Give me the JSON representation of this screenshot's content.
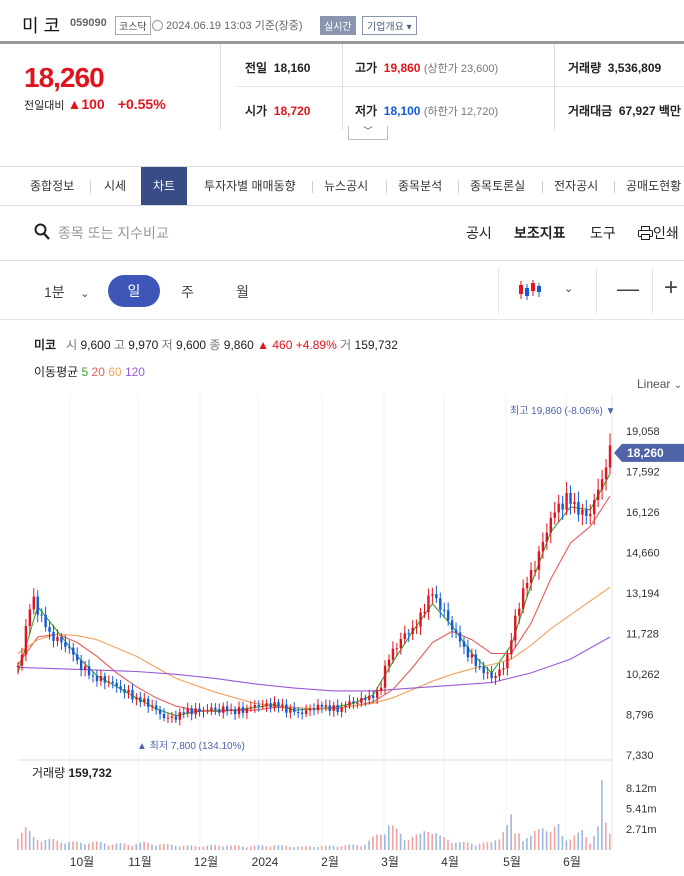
{
  "header": {
    "name": "미 코",
    "code": "059090",
    "market": "코스닥",
    "timestamp": "2024.06.19 13:03  기준(장중)",
    "realtime": "실시간",
    "overview": "기업개요"
  },
  "quote": {
    "price": "18,260",
    "change_label": "전일대비",
    "change": "▲100",
    "change_pct": "+0.55%",
    "prev_label": "전일",
    "prev": "18,160",
    "high_label": "고가",
    "high": "19,860",
    "upper_limit": "(상한가 23,600)",
    "volume_label": "거래량",
    "volume": "3,536,809",
    "open_label": "시가",
    "open": "18,720",
    "low_label": "저가",
    "low": "18,100",
    "lower_limit": "(하한가 12,720)",
    "amount_label": "거래대금",
    "amount": "67,927 백만"
  },
  "tabs": [
    "종합정보",
    "시세",
    "차트",
    "투자자별 매매동향",
    "뉴스공시",
    "종목분석",
    "종목토론실",
    "전자공시",
    "공매도현황"
  ],
  "search": {
    "placeholder": "종목 또는 지수비교",
    "tools": [
      "공시",
      "보조지표",
      "도구",
      "인쇄"
    ]
  },
  "intervals": {
    "minute": "1분",
    "day": "일",
    "week": "주",
    "month": "월"
  },
  "legend": {
    "name": "미코",
    "open_k": "시",
    "open": "9,600",
    "high_k": "고",
    "high": "9,970",
    "low_k": "저",
    "low": "9,600",
    "close_k": "종",
    "close": "9,860",
    "chg": "▲ 460 +4.89%",
    "vol_k": "거",
    "vol": "159,732",
    "ma_label": "이동평균",
    "ma5": "5",
    "ma20": "20",
    "ma60": "60",
    "ma120": "120"
  },
  "scale_label": "Linear",
  "colors": {
    "up": "#e0141e",
    "down": "#1358d6",
    "ma5": "#2fa52f",
    "ma20": "#e45b5b",
    "ma60": "#f0a35e",
    "ma120": "#9b59d9",
    "accent": "#3d56b8"
  },
  "chart_data": {
    "type": "candlestick",
    "y_ticks": [
      "19,058",
      "17,592",
      "16,126",
      "14,660",
      "13,194",
      "11,728",
      "10,262",
      "8,796",
      "7,330"
    ],
    "ylim": [
      7330,
      19990
    ],
    "x_labels": [
      "10월",
      "11월",
      "12월",
      "2024",
      "2월",
      "3월",
      "4월",
      "5월",
      "6월"
    ],
    "current_price": "18,260",
    "max_label": "최고 19,860 (-8.06%)",
    "min_label": "최저 7,800 (134.10%)",
    "close_points": [
      [
        0,
        10500
      ],
      [
        2,
        11000
      ],
      [
        5,
        12500
      ],
      [
        8,
        12900
      ],
      [
        12,
        12300
      ],
      [
        16,
        11700
      ],
      [
        20,
        11500
      ],
      [
        26,
        11200
      ],
      [
        30,
        10700
      ],
      [
        34,
        10400
      ],
      [
        38,
        10150
      ],
      [
        42,
        10050
      ],
      [
        46,
        10000
      ],
      [
        50,
        9800
      ],
      [
        54,
        9650
      ],
      [
        58,
        9450
      ],
      [
        62,
        9300
      ],
      [
        66,
        9200
      ],
      [
        70,
        8950
      ],
      [
        74,
        8700
      ],
      [
        78,
        8650
      ],
      [
        82,
        8800
      ],
      [
        86,
        8950
      ],
      [
        90,
        8900
      ],
      [
        94,
        8950
      ],
      [
        98,
        9000
      ],
      [
        102,
        8950
      ],
      [
        106,
        9000
      ],
      [
        110,
        8900
      ],
      [
        114,
        8950
      ],
      [
        118,
        9050
      ],
      [
        122,
        9150
      ],
      [
        126,
        9100
      ],
      [
        130,
        9200
      ],
      [
        134,
        9050
      ],
      [
        138,
        8950
      ],
      [
        142,
        8850
      ],
      [
        146,
        8900
      ],
      [
        150,
        9050
      ],
      [
        154,
        9100
      ],
      [
        158,
        9050
      ],
      [
        162,
        8950
      ],
      [
        166,
        9150
      ],
      [
        170,
        9250
      ],
      [
        174,
        9300
      ],
      [
        178,
        9450
      ],
      [
        182,
        9500
      ],
      [
        184,
        9900
      ],
      [
        186,
        10500
      ],
      [
        190,
        11100
      ],
      [
        194,
        11500
      ],
      [
        198,
        11800
      ],
      [
        202,
        12000
      ],
      [
        206,
        12700
      ],
      [
        210,
        13200
      ],
      [
        214,
        12700
      ],
      [
        218,
        12200
      ],
      [
        222,
        11700
      ],
      [
        226,
        11200
      ],
      [
        230,
        10800
      ],
      [
        234,
        10500
      ],
      [
        238,
        10200
      ],
      [
        242,
        10200
      ],
      [
        246,
        10500
      ],
      [
        249,
        11200
      ],
      [
        252,
        12200
      ],
      [
        255,
        13100
      ],
      [
        258,
        13600
      ],
      [
        262,
        14200
      ],
      [
        266,
        15000
      ],
      [
        270,
        15900
      ],
      [
        274,
        16300
      ],
      [
        278,
        16600
      ],
      [
        282,
        16400
      ],
      [
        286,
        16000
      ],
      [
        290,
        16100
      ],
      [
        294,
        16900
      ],
      [
        296,
        17300
      ],
      [
        298,
        17900
      ],
      [
        300,
        18260
      ]
    ],
    "ma5_points": [
      [
        0,
        10300
      ],
      [
        10,
        12700
      ],
      [
        20,
        11800
      ],
      [
        30,
        10900
      ],
      [
        40,
        10200
      ],
      [
        50,
        9800
      ],
      [
        60,
        9400
      ],
      [
        70,
        9000
      ],
      [
        80,
        8750
      ],
      [
        90,
        8900
      ],
      [
        100,
        8950
      ],
      [
        110,
        8950
      ],
      [
        120,
        9050
      ],
      [
        130,
        9150
      ],
      [
        140,
        8950
      ],
      [
        150,
        9000
      ],
      [
        160,
        9050
      ],
      [
        170,
        9200
      ],
      [
        180,
        9500
      ],
      [
        190,
        10700
      ],
      [
        200,
        11800
      ],
      [
        210,
        12800
      ],
      [
        220,
        12000
      ],
      [
        230,
        11000
      ],
      [
        240,
        10300
      ],
      [
        250,
        11300
      ],
      [
        260,
        13500
      ],
      [
        270,
        15400
      ],
      [
        280,
        16300
      ],
      [
        290,
        16200
      ],
      [
        300,
        17500
      ]
    ],
    "ma20_points": [
      [
        0,
        10600
      ],
      [
        10,
        11600
      ],
      [
        20,
        11700
      ],
      [
        30,
        11400
      ],
      [
        40,
        10900
      ],
      [
        50,
        10300
      ],
      [
        60,
        9800
      ],
      [
        70,
        9400
      ],
      [
        80,
        9100
      ],
      [
        90,
        8950
      ],
      [
        100,
        8900
      ],
      [
        110,
        8950
      ],
      [
        120,
        8950
      ],
      [
        130,
        9050
      ],
      [
        140,
        9050
      ],
      [
        150,
        9000
      ],
      [
        160,
        9000
      ],
      [
        170,
        9100
      ],
      [
        180,
        9250
      ],
      [
        190,
        9700
      ],
      [
        200,
        10500
      ],
      [
        210,
        11400
      ],
      [
        220,
        11800
      ],
      [
        230,
        11500
      ],
      [
        240,
        11000
      ],
      [
        250,
        11000
      ],
      [
        260,
        12100
      ],
      [
        270,
        13700
      ],
      [
        280,
        15000
      ],
      [
        290,
        15600
      ],
      [
        300,
        16700
      ]
    ],
    "ma60_points": [
      [
        0,
        11000
      ],
      [
        10,
        11500
      ],
      [
        20,
        11700
      ],
      [
        30,
        11650
      ],
      [
        40,
        11500
      ],
      [
        50,
        11200
      ],
      [
        60,
        10900
      ],
      [
        70,
        10500
      ],
      [
        80,
        10100
      ],
      [
        90,
        9850
      ],
      [
        100,
        9600
      ],
      [
        110,
        9400
      ],
      [
        120,
        9200
      ],
      [
        130,
        9100
      ],
      [
        140,
        9050
      ],
      [
        150,
        9000
      ],
      [
        160,
        9000
      ],
      [
        170,
        9100
      ],
      [
        180,
        9200
      ],
      [
        190,
        9400
      ],
      [
        200,
        9700
      ],
      [
        210,
        10000
      ],
      [
        220,
        10250
      ],
      [
        230,
        10450
      ],
      [
        240,
        10600
      ],
      [
        250,
        10800
      ],
      [
        260,
        11300
      ],
      [
        270,
        11900
      ],
      [
        280,
        12400
      ],
      [
        290,
        12900
      ],
      [
        300,
        13400
      ]
    ],
    "ma120_points": [
      [
        0,
        10500
      ],
      [
        20,
        10450
      ],
      [
        40,
        10400
      ],
      [
        60,
        10350
      ],
      [
        80,
        10250
      ],
      [
        100,
        10100
      ],
      [
        120,
        9900
      ],
      [
        140,
        9750
      ],
      [
        160,
        9650
      ],
      [
        180,
        9650
      ],
      [
        200,
        9750
      ],
      [
        220,
        9850
      ],
      [
        240,
        9950
      ],
      [
        260,
        10300
      ],
      [
        280,
        10800
      ],
      [
        300,
        11600
      ]
    ],
    "volume_label": "거래량",
    "volume_value": "159,732",
    "volume_ticks": [
      "8.12m",
      "5.41m",
      "2.71m"
    ],
    "volume_ylim": [
      0,
      10700000
    ],
    "volume_bars": [
      [
        0,
        2100000
      ],
      [
        4,
        2600000
      ],
      [
        8,
        1500000
      ],
      [
        14,
        1300000
      ],
      [
        22,
        1100000
      ],
      [
        30,
        900000
      ],
      [
        38,
        1000000
      ],
      [
        46,
        800000
      ],
      [
        56,
        700000
      ],
      [
        64,
        900000
      ],
      [
        72,
        700000
      ],
      [
        80,
        600000
      ],
      [
        88,
        500000
      ],
      [
        96,
        500000
      ],
      [
        104,
        600000
      ],
      [
        112,
        500000
      ],
      [
        120,
        500000
      ],
      [
        128,
        600000
      ],
      [
        136,
        500000
      ],
      [
        144,
        400000
      ],
      [
        152,
        500000
      ],
      [
        160,
        500000
      ],
      [
        168,
        600000
      ],
      [
        176,
        700000
      ],
      [
        184,
        2200000
      ],
      [
        188,
        3200000
      ],
      [
        196,
        1500000
      ],
      [
        204,
        1800000
      ],
      [
        208,
        2900000
      ],
      [
        214,
        1600000
      ],
      [
        224,
        900000
      ],
      [
        232,
        800000
      ],
      [
        240,
        900000
      ],
      [
        248,
        2800000
      ],
      [
        250,
        3900000
      ],
      [
        252,
        2000000
      ],
      [
        254,
        2500000
      ],
      [
        256,
        1400000
      ],
      [
        260,
        1600000
      ],
      [
        264,
        2600000
      ],
      [
        266,
        3500000
      ],
      [
        270,
        2200000
      ],
      [
        274,
        2900000
      ],
      [
        276,
        1800000
      ],
      [
        280,
        1500000
      ],
      [
        284,
        1900000
      ],
      [
        286,
        2300000
      ],
      [
        290,
        1200000
      ],
      [
        294,
        2700000
      ],
      [
        296,
        7600000
      ],
      [
        298,
        3200000
      ],
      [
        300,
        2300000
      ]
    ]
  }
}
